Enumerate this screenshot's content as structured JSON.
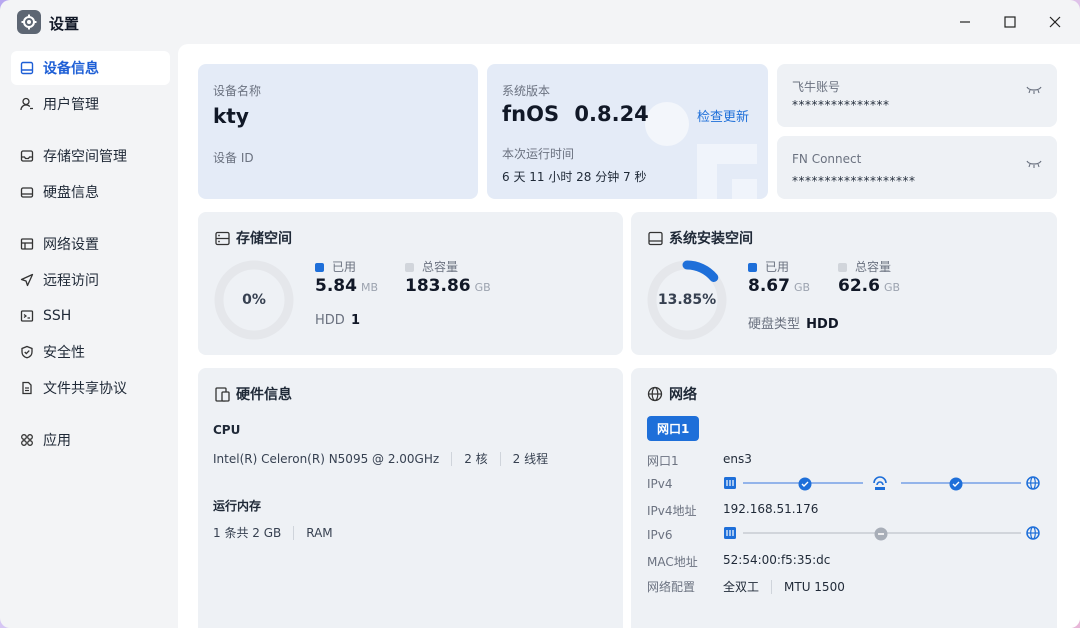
{
  "window": {
    "title": "设置"
  },
  "sidebar": {
    "items": [
      {
        "label": "设备信息",
        "icon": "device-icon",
        "active": true
      },
      {
        "label": "用户管理",
        "icon": "user-icon"
      },
      {
        "label": "存储空间管理",
        "icon": "storage-icon"
      },
      {
        "label": "硬盘信息",
        "icon": "disk-icon"
      },
      {
        "label": "网络设置",
        "icon": "network-icon"
      },
      {
        "label": "远程访问",
        "icon": "send-icon"
      },
      {
        "label": "SSH",
        "icon": "terminal-icon"
      },
      {
        "label": "安全性",
        "icon": "shield-icon"
      },
      {
        "label": "文件共享协议",
        "icon": "file-icon"
      },
      {
        "label": "应用",
        "icon": "apps-icon"
      }
    ]
  },
  "device": {
    "name_label": "设备名称",
    "name_value": "kty",
    "id_label": "设备 ID"
  },
  "system": {
    "version_label": "系统版本",
    "version_name": "fnOS",
    "version_number": "0.8.24",
    "check_update": "检查更新",
    "uptime_label": "本次运行时间",
    "uptime_value": "6 天 11 小时 28 分钟 7 秒"
  },
  "account": {
    "label": "飞牛账号",
    "masked": "***************"
  },
  "fnconnect": {
    "label": "FN Connect",
    "masked": "*******************"
  },
  "storage": {
    "title": "存储空间",
    "percent_text": "0%",
    "percent": 0,
    "used_label": "已用",
    "used_value": "5.84",
    "used_unit": "MB",
    "total_label": "总容量",
    "total_value": "183.86",
    "total_unit": "GB",
    "disk_type": "HDD",
    "disk_count": "1"
  },
  "sysinstall": {
    "title": "系统安装空间",
    "percent_text": "13.85%",
    "percent": 13.85,
    "used_label": "已用",
    "used_value": "8.67",
    "used_unit": "GB",
    "total_label": "总容量",
    "total_value": "62.6",
    "total_unit": "GB",
    "disk_type_label": "硬盘类型",
    "disk_type": "HDD"
  },
  "hardware": {
    "title": "硬件信息",
    "cpu_label": "CPU",
    "cpu_model": "Intel(R) Celeron(R) N5095 @ 2.00GHz",
    "cpu_cores": "2 核",
    "cpu_threads": "2 线程",
    "mem_label": "运行内存",
    "mem_detail": "1 条共 2 GB",
    "mem_type": "RAM"
  },
  "network": {
    "title": "网络",
    "tab": "网口1",
    "rows": [
      {
        "label": "网口1",
        "value": "ens3"
      },
      {
        "label": "IPv4",
        "value": ""
      },
      {
        "label": "IPv4地址",
        "value": "192.168.51.176"
      },
      {
        "label": "IPv6",
        "value": ""
      },
      {
        "label": "MAC地址",
        "value": "52:54:00:f5:35:dc"
      },
      {
        "label": "网络配置",
        "value": "全双工",
        "value2": "MTU 1500"
      }
    ]
  },
  "colors": {
    "accent": "#1e6fd9",
    "gauge_track": "#e5e7eb",
    "legend_total": "#d1d5db"
  }
}
